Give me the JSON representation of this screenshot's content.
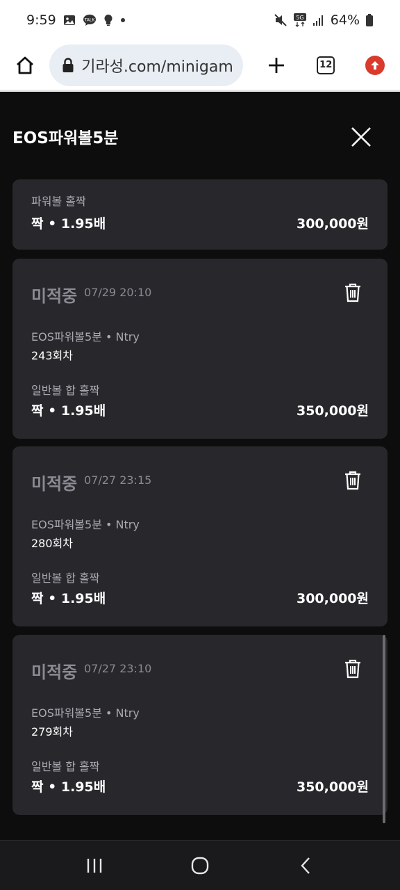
{
  "status_bar": {
    "time": "9:59",
    "battery": "64%",
    "network": "5G"
  },
  "browser": {
    "url": "기라성.com/minigam",
    "tab_count": "12"
  },
  "modal": {
    "title": "EOS파워볼5분",
    "summary": {
      "label": "파워볼 홀짝",
      "pick": "짝 • 1.95배",
      "amount": "300,000원"
    },
    "bets": [
      {
        "status": "미적중",
        "date": "07/29 20:10",
        "game": "EOS파워볼5분 • Ntry",
        "round": "243회차",
        "label": "일반볼 합 홀짝",
        "pick": "짝 • 1.95배",
        "amount": "350,000원"
      },
      {
        "status": "미적중",
        "date": "07/27 23:15",
        "game": "EOS파워볼5분 • Ntry",
        "round": "280회차",
        "label": "일반볼 합 홀짝",
        "pick": "짝 • 1.95배",
        "amount": "300,000원"
      },
      {
        "status": "미적중",
        "date": "07/27 23:10",
        "game": "EOS파워볼5분 • Ntry",
        "round": "279회차",
        "label": "일반볼 합 홀짝",
        "pick": "짝 • 1.95배",
        "amount": "350,000원"
      }
    ]
  },
  "colors": {
    "background": "#0d0d0d",
    "card": "#27272c",
    "muted": "#8a8a92",
    "update_accent": "#d93a2b"
  }
}
